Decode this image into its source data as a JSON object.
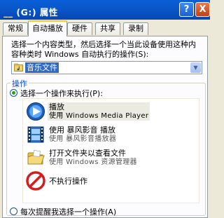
{
  "window": {
    "title": "__ (G:) 属性",
    "help_label": "?",
    "close_label": "X"
  },
  "tabs": [
    {
      "label": "常规",
      "active": false
    },
    {
      "label": "自动播放",
      "active": true
    },
    {
      "label": "硬件",
      "active": false
    },
    {
      "label": "共享",
      "active": false
    },
    {
      "label": "录制",
      "active": false
    }
  ],
  "content_type": {
    "description": "选择一个内容类型，然后选择一个当此设备使用这种内容种类时 Windows 自动执行的操作(S):",
    "selected": "音乐文件"
  },
  "actions": {
    "group_label": "操作",
    "option_select": "选择一个操作来执行(P):",
    "option_prompt": "每次提醒我选择一个操作(A)",
    "items": [
      {
        "title": "播放",
        "subtitle": "使用 Windows Media Player",
        "icon": "media-player-icon",
        "selected": true
      },
      {
        "title": "使用 暴风影音 播放",
        "subtitle": "使用 暴风影音播放器",
        "icon": "storm-player-icon",
        "selected": false
      },
      {
        "title": "打开文件夹以查看文件",
        "subtitle": "使用 Windows 资源管理器",
        "icon": "folder-icon",
        "selected": false
      },
      {
        "title": "不执行操作",
        "icon": "no-action-icon",
        "selected": false
      }
    ]
  },
  "colors": {
    "titlebar": "#0954c6",
    "selected_value_bg": "#316ac5",
    "group_label": "#0046d5",
    "tab_highlight": "#ffc83c"
  }
}
